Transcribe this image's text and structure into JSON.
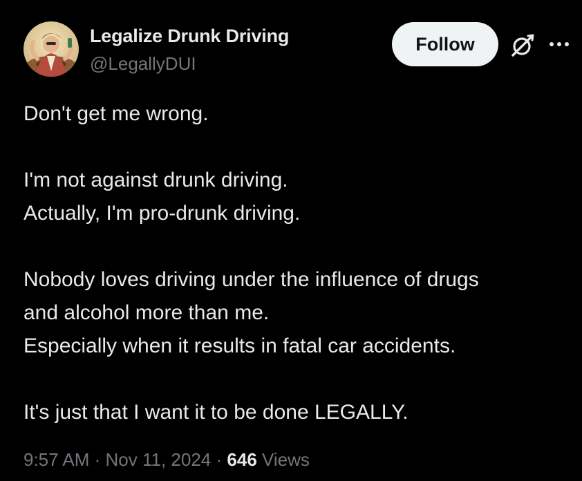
{
  "author": {
    "display_name": "Legalize Drunk Driving",
    "handle": "@LegallyDUI"
  },
  "actions": {
    "follow_label": "Follow",
    "grok_icon": "grok-icon",
    "more_icon": "more-icon"
  },
  "tweet": {
    "lines": [
      "Don't get me wrong.",
      "",
      "I'm not against drunk driving.",
      "Actually, I'm pro-drunk driving.",
      "",
      "Nobody loves driving under the influence of drugs",
      "and alcohol more than me.",
      "Especially when it results in fatal car accidents.",
      "",
      "It's just that I want it to be done LEGALLY."
    ]
  },
  "meta": {
    "time": "9:57 AM",
    "separator": "·",
    "date": "Nov 11, 2024",
    "views_count": "646",
    "views_label": "Views"
  },
  "colors": {
    "background": "#000000",
    "primary_text": "#e7e9ea",
    "secondary_text": "#71767b",
    "follow_button_bg": "#eff3f4",
    "follow_button_text": "#0f1419"
  }
}
